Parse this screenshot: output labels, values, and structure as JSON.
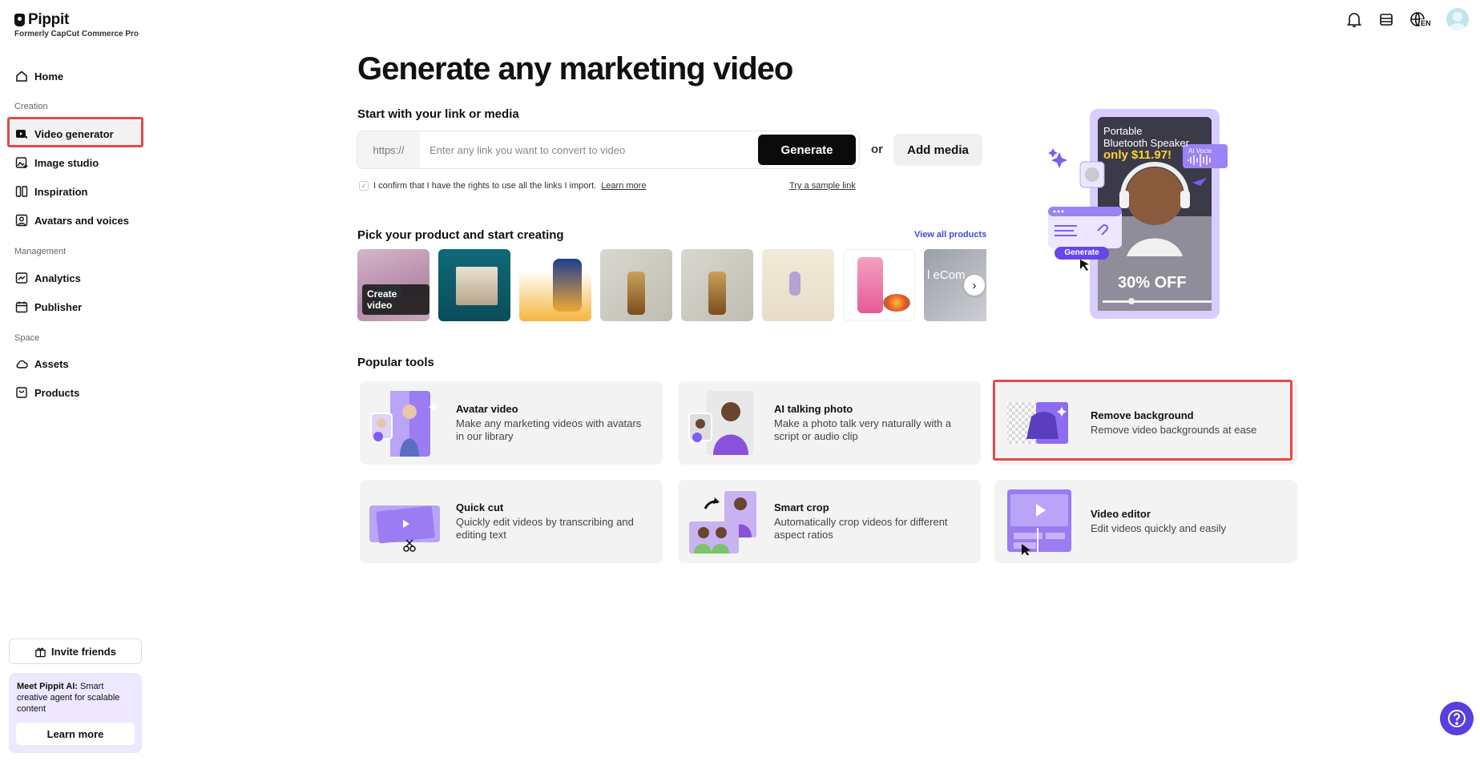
{
  "app": {
    "name": "Pippit",
    "subtitle": "Formerly CapCut Commerce Pro"
  },
  "sidebar": {
    "home": "Home",
    "sections": {
      "creation": "Creation",
      "management": "Management",
      "space": "Space"
    },
    "items": [
      {
        "label": "Video generator",
        "icon": "video-generator-icon",
        "active": true
      },
      {
        "label": "Image studio",
        "icon": "image-studio-icon"
      },
      {
        "label": "Inspiration",
        "icon": "inspiration-icon"
      },
      {
        "label": "Avatars and voices",
        "icon": "avatar-voice-icon"
      },
      {
        "label": "Analytics",
        "icon": "analytics-icon"
      },
      {
        "label": "Publisher",
        "icon": "calendar-icon"
      },
      {
        "label": "Assets",
        "icon": "cloud-icon"
      },
      {
        "label": "Products",
        "icon": "box-icon"
      }
    ],
    "invite": "Invite friends",
    "promo": {
      "bold": "Meet Pippit AI:",
      "text": " Smart creative agent for scalable content",
      "button": "Learn more"
    }
  },
  "header": {
    "lang": "EN"
  },
  "main": {
    "title": "Generate any marketing video",
    "start_label": "Start with your link or media",
    "link_prefix": "https://",
    "link_placeholder": "Enter any link you want to convert to video",
    "generate": "Generate",
    "or": "or",
    "add_media": "Add media",
    "confirm_text": "I confirm that I have the rights to use all the links I import.",
    "learn_more": "Learn more",
    "sample_link": "Try a sample link",
    "pick_title": "Pick your product and start creating",
    "view_all": "View all products",
    "create_video": "Create video",
    "ecom_snippet": "l eCom",
    "tools_title": "Popular tools",
    "tools": [
      {
        "name": "Avatar video",
        "desc": "Make any marketing videos with avatars in our library"
      },
      {
        "name": "AI talking photo",
        "desc": "Make a photo talk very naturally with a script or audio clip"
      },
      {
        "name": "Remove background",
        "desc": "Remove video backgrounds at ease"
      },
      {
        "name": "Quick cut",
        "desc": "Quickly edit videos by transcribing and editing text"
      },
      {
        "name": "Smart crop",
        "desc": "Automatically crop videos for different aspect ratios"
      },
      {
        "name": "Video editor",
        "desc": "Edit videos quickly and easily"
      }
    ]
  },
  "hero": {
    "line1": "Portable",
    "line2": "Bluetooth Speaker",
    "price": "only $11.97!",
    "voice": "AI Vocie",
    "generate": "Generate",
    "discount": "30% OFF"
  },
  "colors": {
    "accent": "#7c5cf0",
    "highlight": "#e5484d",
    "link": "#3b4bdb"
  }
}
